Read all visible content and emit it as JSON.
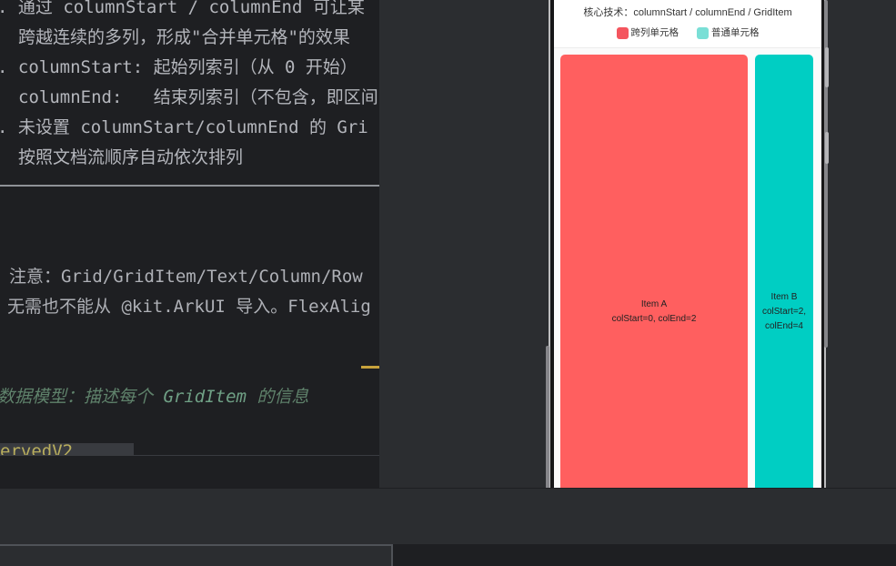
{
  "editor": {
    "doc_lines": [
      ". 通过 columnStart / columnEnd 可让某",
      "跨越连续的多列，形成\"合并单元格\"的效果",
      ". columnStart: 起始列索引（从 0 开始）",
      "columnEnd:   结束列索引（不包含，即区间",
      ". 未设置 columnStart/columnEnd 的 Gri",
      "按照文档流顺序自动依次排列"
    ],
    "note_lines": [
      "注意：Grid/GridItem/Text/Column/Row",
      "无需也不能从 @kit.ArkUI 导入。FlexAlig"
    ],
    "comment": {
      "prefix": "数据模型：描述每个 ",
      "keyword": "GridItem",
      "suffix": " 的信息"
    },
    "sticky_line": "ervedV2"
  },
  "preview": {
    "title": "核心技术：columnStart / columnEnd / GridItem",
    "legend": [
      {
        "label": "跨列单元格",
        "color": "#f4555e"
      },
      {
        "label": "普通单元格",
        "color": "#7adfd6"
      }
    ],
    "cells": [
      {
        "name": "Item A",
        "detail": "colStart=0, colEnd=2",
        "color": "#ff5f5f"
      },
      {
        "name": "Item B",
        "detail": "colStart=2, colEnd=4",
        "color": "#00cec3"
      }
    ]
  }
}
